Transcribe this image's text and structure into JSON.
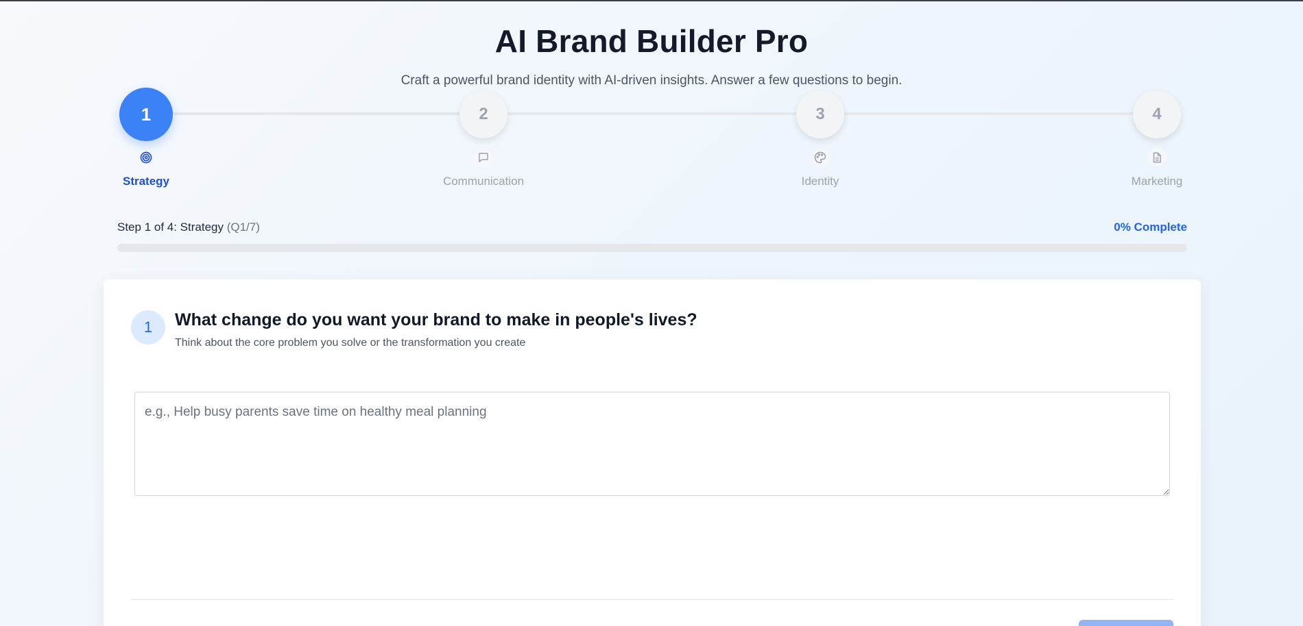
{
  "app": {
    "title": "AI Brand Builder Pro",
    "subtitle": "Craft a powerful brand identity with AI-driven insights. Answer a few questions to begin."
  },
  "colors": {
    "accent": "#3b82f6",
    "accent_dark": "#1d4ed8",
    "inactive": "#9ca3af"
  },
  "stepper": {
    "steps": [
      {
        "number": "1",
        "label": "Strategy",
        "icon": "target-icon",
        "active": true
      },
      {
        "number": "2",
        "label": "Communication",
        "icon": "message-square-icon",
        "active": false
      },
      {
        "number": "3",
        "label": "Identity",
        "icon": "palette-icon",
        "active": false
      },
      {
        "number": "4",
        "label": "Marketing",
        "icon": "document-icon",
        "active": false
      }
    ]
  },
  "progress": {
    "step_text": "Step 1 of 4: Strategy",
    "question_text": "(Q1/7)",
    "percent_text": "0% Complete",
    "percent_value": 0
  },
  "question": {
    "number": "1",
    "title": "What change do you want your brand to make in people's lives?",
    "hint": "Think about the core problem you solve or the transformation you create",
    "value": "",
    "placeholder": "e.g., Help busy parents save time on healthy meal planning"
  }
}
